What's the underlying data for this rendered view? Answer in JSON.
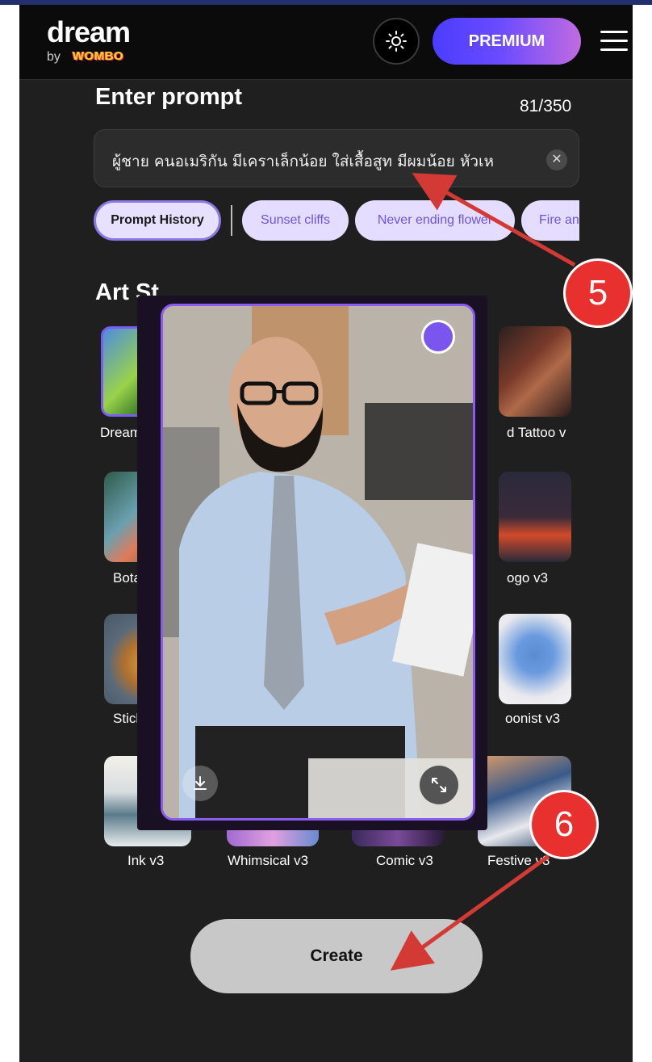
{
  "header": {
    "logo_main": "dream",
    "logo_by": "by",
    "logo_brand": "WOMBO",
    "theme_icon": "sun-icon",
    "premium_label": "PREMIUM",
    "menu_icon": "hamburger-menu-icon"
  },
  "prompt": {
    "title": "Enter prompt",
    "char_count": "81/350",
    "value": "ผู้ชาย คนอเมริกัน มีเคราเล็กน้อย ใส่เสื้อสูท มีผมน้อย หัวเห",
    "clear_icon": "close-icon"
  },
  "chips": {
    "history_label": "Prompt History",
    "suggestions": [
      "Sunset cliffs",
      "Never ending flower",
      "Fire an"
    ]
  },
  "art_style": {
    "title": "Art Style",
    "title_visible": "Art St",
    "tiles": [
      {
        "label": "Dreamla",
        "selected": true
      },
      {
        "label": "d Tattoo v",
        "selected": false
      },
      {
        "label": "Botany",
        "selected": false
      },
      {
        "label": "ogo v3",
        "selected": false
      },
      {
        "label": "Sticke",
        "selected": false
      },
      {
        "label": "oonist v3",
        "selected": false
      },
      {
        "label": "Ink v3",
        "selected": false
      },
      {
        "label": "Whimsical v3",
        "selected": false
      },
      {
        "label": "Comic v3",
        "selected": false
      },
      {
        "label": "Festive v3",
        "selected": false
      }
    ]
  },
  "preview": {
    "select_indicator_color": "#7a56ee",
    "download_icon": "download-icon",
    "expand_icon": "expand-icon"
  },
  "create_label": "Create",
  "annotations": {
    "step_5": "5",
    "step_6": "6",
    "color": "#e8312f"
  },
  "colors": {
    "accent": "#7b5cf0",
    "background": "#1f1f1f",
    "header": "#0b0b0b"
  }
}
